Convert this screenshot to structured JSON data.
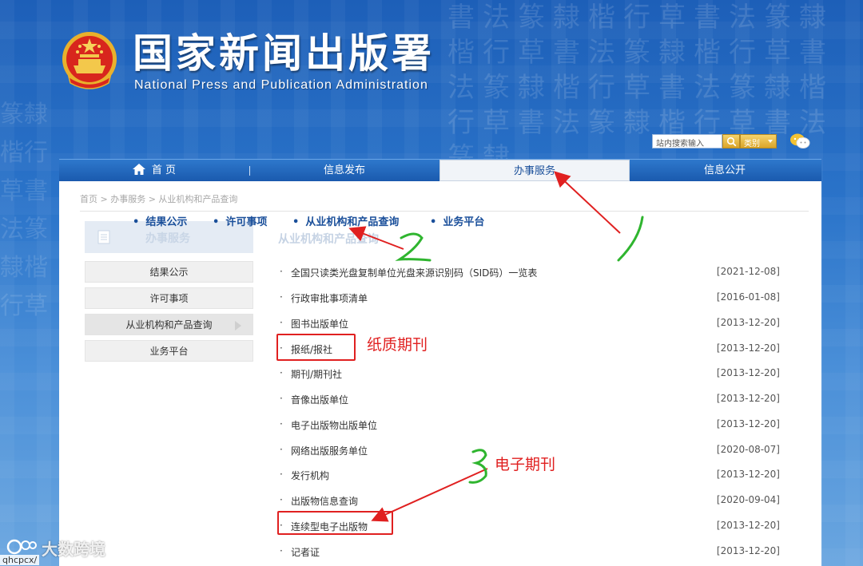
{
  "header": {
    "title": "国家新闻出版署",
    "subtitle": "National  Press and Publication Administration"
  },
  "search": {
    "placeholder": "站内搜索输入",
    "category_label": "类别"
  },
  "nav": {
    "items": [
      {
        "label": "首 页"
      },
      {
        "label": "信息发布"
      },
      {
        "label": "办事服务"
      },
      {
        "label": "信息公开"
      }
    ],
    "active_label": "办事服务"
  },
  "breadcrumb": "首页 > 办事服务 > 从业机构和产品查询",
  "subnav": {
    "items": [
      "结果公示",
      "许可事项",
      "从业机构和产品查询",
      "业务平台"
    ]
  },
  "sidebar": {
    "heading": "办事服务",
    "items": [
      {
        "label": "结果公示"
      },
      {
        "label": "许可事项"
      },
      {
        "label": "从业机构和产品查询"
      },
      {
        "label": "业务平台"
      }
    ]
  },
  "main": {
    "section_title": "从业机构和产品查询",
    "list": [
      {
        "title": "全国只读类光盘复制单位光盘来源识别码（SID码）一览表",
        "date": "[2021-12-08]"
      },
      {
        "title": "行政审批事项清单",
        "date": "[2016-01-08]"
      },
      {
        "title": "图书出版单位",
        "date": "[2013-12-20]"
      },
      {
        "title": "报纸/报社",
        "date": "[2013-12-20]"
      },
      {
        "title": "期刊/期刊社",
        "date": "[2013-12-20]"
      },
      {
        "title": "音像出版单位",
        "date": "[2013-12-20]"
      },
      {
        "title": "电子出版物出版单位",
        "date": "[2013-12-20]"
      },
      {
        "title": "网络出版服务单位",
        "date": "[2020-08-07]"
      },
      {
        "title": "发行机构",
        "date": "[2013-12-20]"
      },
      {
        "title": "出版物信息查询",
        "date": "[2020-09-04]"
      },
      {
        "title": "连续型电子出版物",
        "date": "[2013-12-20]"
      },
      {
        "title": "记者证",
        "date": "[2013-12-20]"
      }
    ]
  },
  "annotations": {
    "paper_label": "纸质期刊",
    "electronic_label": "电子期刊"
  },
  "watermark": {
    "brand": "大数跨境",
    "url": "qhcpcx/"
  },
  "colors": {
    "accent_red": "#e02020",
    "annotation_green": "#2fb52f",
    "nav_blue": "#1a5aae",
    "link_blue": "#1a4f9a"
  }
}
